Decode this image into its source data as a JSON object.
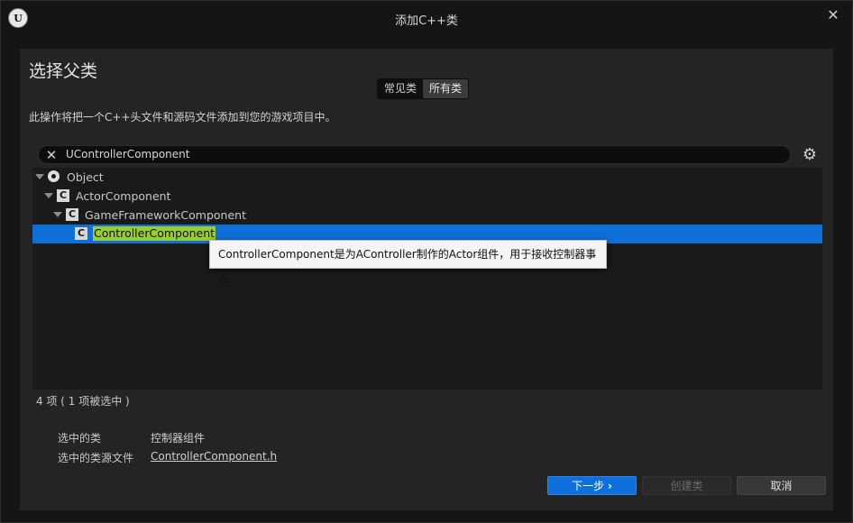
{
  "window": {
    "title": "添加C++类",
    "logo_text": "U",
    "close_glyph": "✕"
  },
  "header": {
    "heading": "选择父类",
    "tabs": [
      {
        "label": "常见类",
        "active": false
      },
      {
        "label": "所有类",
        "active": true
      }
    ],
    "description": "此操作将把一个C++头文件和源码文件添加到您的游戏项目中。"
  },
  "search": {
    "value": "UControllerComponent",
    "placeholder": "",
    "clear_glyph": "✕",
    "settings_glyph": "⚙"
  },
  "tree": {
    "items": [
      {
        "label": "Object",
        "icon": "object-icon",
        "expanded": true,
        "selected": false
      },
      {
        "label": "ActorComponent",
        "icon": "class-icon",
        "expanded": true,
        "selected": false
      },
      {
        "label": "GameFrameworkComponent",
        "icon": "class-icon",
        "expanded": true,
        "selected": false
      },
      {
        "label": "ControllerComponent",
        "icon": "class-icon",
        "expanded": false,
        "selected": true
      }
    ],
    "class_glyph": "C"
  },
  "tooltip": {
    "text": "ControllerComponent是为AController制作的Actor组件，用于接收控制器事件。"
  },
  "status": {
    "count": "4 项 ( 1 项被选中 )"
  },
  "selection": {
    "class_label": "选中的类",
    "class_value": "控制器组件",
    "source_label": "选中的类源文件",
    "source_value": "ControllerComponent.h"
  },
  "buttons": {
    "next": "下一步",
    "next_glyph": "›",
    "create": "创建类",
    "cancel": "取消"
  },
  "colors": {
    "selection": "#0e6fd6",
    "highlight": "#9acd32",
    "primary_button": "#0f6fdd"
  }
}
